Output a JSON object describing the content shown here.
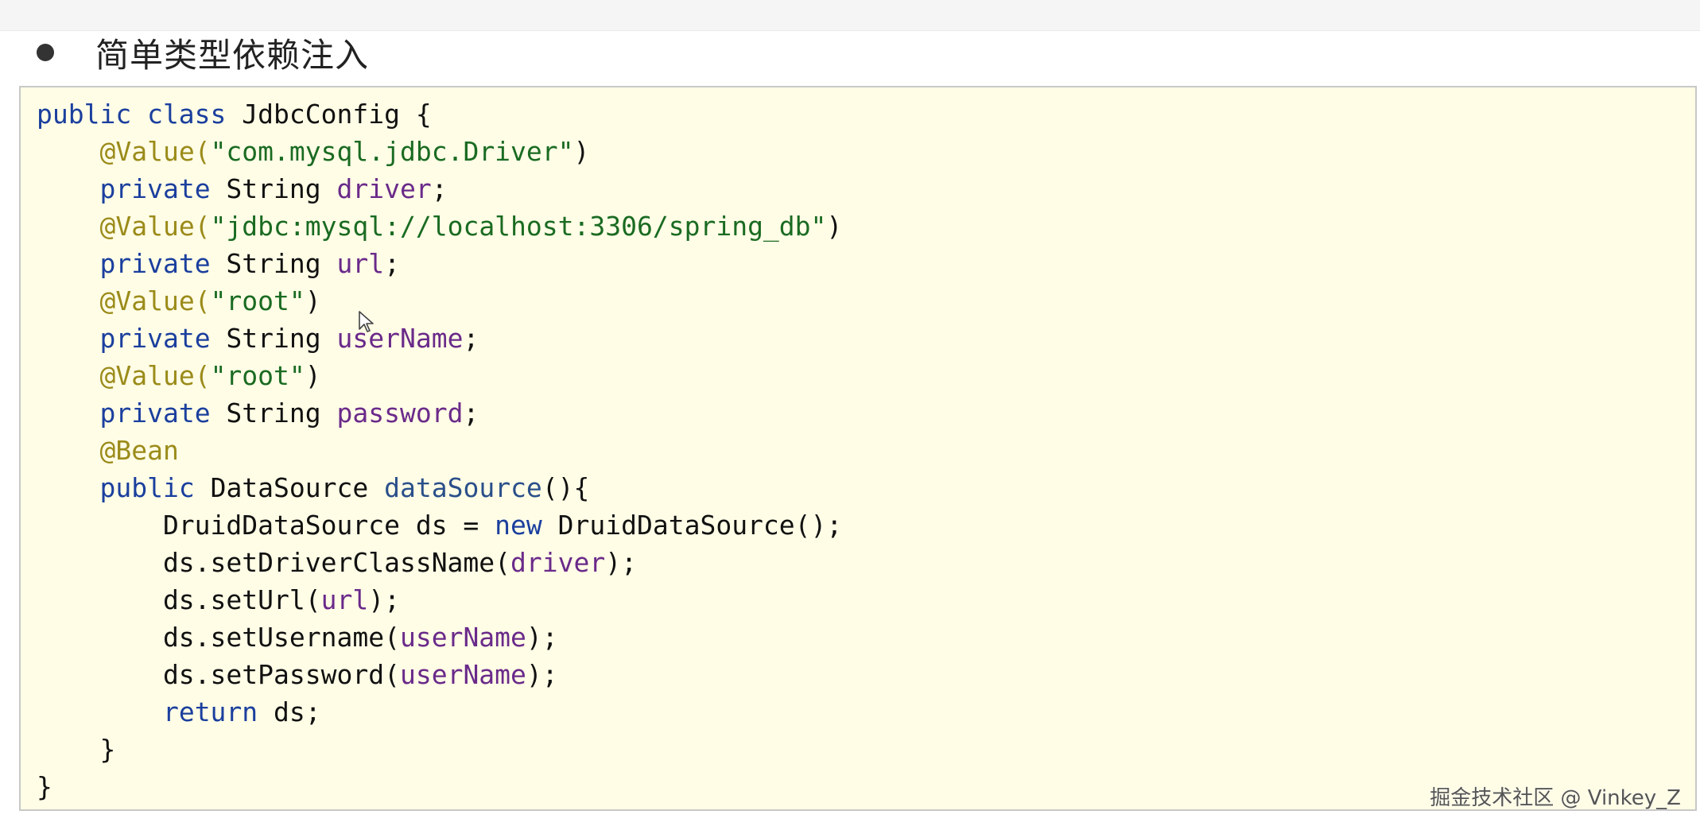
{
  "heading": {
    "bullet_icon": "bullet-dot-icon",
    "title": "简单类型依赖注入"
  },
  "code": {
    "lines": [
      [
        {
          "t": "public class",
          "c": "kw"
        },
        {
          "t": " JdbcConfig {",
          "c": "plain"
        }
      ],
      [
        {
          "t": "    ",
          "c": "plain"
        },
        {
          "t": "@Value(",
          "c": "ann"
        },
        {
          "t": "\"com.mysql.jdbc.Driver\"",
          "c": "str"
        },
        {
          "t": ")",
          "c": "plain"
        }
      ],
      [
        {
          "t": "    ",
          "c": "plain"
        },
        {
          "t": "private",
          "c": "kw"
        },
        {
          "t": " String ",
          "c": "plain"
        },
        {
          "t": "driver",
          "c": "field"
        },
        {
          "t": ";",
          "c": "plain"
        }
      ],
      [
        {
          "t": "    ",
          "c": "plain"
        },
        {
          "t": "@Value(",
          "c": "ann"
        },
        {
          "t": "\"jdbc:mysql://localhost:3306/spring_db\"",
          "c": "str"
        },
        {
          "t": ")",
          "c": "plain"
        }
      ],
      [
        {
          "t": "    ",
          "c": "plain"
        },
        {
          "t": "private",
          "c": "kw"
        },
        {
          "t": " String ",
          "c": "plain"
        },
        {
          "t": "url",
          "c": "field"
        },
        {
          "t": ";",
          "c": "plain"
        }
      ],
      [
        {
          "t": "    ",
          "c": "plain"
        },
        {
          "t": "@Value(",
          "c": "ann"
        },
        {
          "t": "\"root\"",
          "c": "str"
        },
        {
          "t": ")",
          "c": "plain"
        }
      ],
      [
        {
          "t": "    ",
          "c": "plain"
        },
        {
          "t": "private",
          "c": "kw"
        },
        {
          "t": " String ",
          "c": "plain"
        },
        {
          "t": "userName",
          "c": "field"
        },
        {
          "t": ";",
          "c": "plain"
        }
      ],
      [
        {
          "t": "    ",
          "c": "plain"
        },
        {
          "t": "@Value(",
          "c": "ann"
        },
        {
          "t": "\"root\"",
          "c": "str"
        },
        {
          "t": ")",
          "c": "plain"
        }
      ],
      [
        {
          "t": "    ",
          "c": "plain"
        },
        {
          "t": "private",
          "c": "kw"
        },
        {
          "t": " String ",
          "c": "plain"
        },
        {
          "t": "password",
          "c": "field"
        },
        {
          "t": ";",
          "c": "plain"
        }
      ],
      [
        {
          "t": "    ",
          "c": "plain"
        },
        {
          "t": "@Bean",
          "c": "ann"
        }
      ],
      [
        {
          "t": "    ",
          "c": "plain"
        },
        {
          "t": "public",
          "c": "kw"
        },
        {
          "t": " DataSource ",
          "c": "plain"
        },
        {
          "t": "dataSource",
          "c": "method"
        },
        {
          "t": "(){",
          "c": "plain"
        }
      ],
      [
        {
          "t": "        DruidDataSource ds = ",
          "c": "plain"
        },
        {
          "t": "new",
          "c": "kw"
        },
        {
          "t": " DruidDataSource();",
          "c": "plain"
        }
      ],
      [
        {
          "t": "        ds.setDriverClassName(",
          "c": "plain"
        },
        {
          "t": "driver",
          "c": "field"
        },
        {
          "t": ");",
          "c": "plain"
        }
      ],
      [
        {
          "t": "        ds.setUrl(",
          "c": "plain"
        },
        {
          "t": "url",
          "c": "field"
        },
        {
          "t": ");",
          "c": "plain"
        }
      ],
      [
        {
          "t": "        ds.setUsername(",
          "c": "plain"
        },
        {
          "t": "userName",
          "c": "field"
        },
        {
          "t": ");",
          "c": "plain"
        }
      ],
      [
        {
          "t": "        ds.setPassword(",
          "c": "plain"
        },
        {
          "t": "userName",
          "c": "field"
        },
        {
          "t": ");",
          "c": "plain"
        }
      ],
      [
        {
          "t": "        ",
          "c": "plain"
        },
        {
          "t": "return",
          "c": "kw"
        },
        {
          "t": " ds;",
          "c": "plain"
        }
      ],
      [
        {
          "t": "    }",
          "c": "plain"
        }
      ],
      [
        {
          "t": "}",
          "c": "plain"
        }
      ]
    ]
  },
  "cursor": {
    "icon": "mouse-pointer-icon"
  },
  "watermark": {
    "text": "掘金技术社区 @ Vinkey_Z"
  },
  "colors": {
    "keyword": "#1b3f9e",
    "annotation": "#9b8b1a",
    "string": "#1a6b22",
    "field": "#6a2a8a",
    "panel_background": "#fffde6"
  }
}
